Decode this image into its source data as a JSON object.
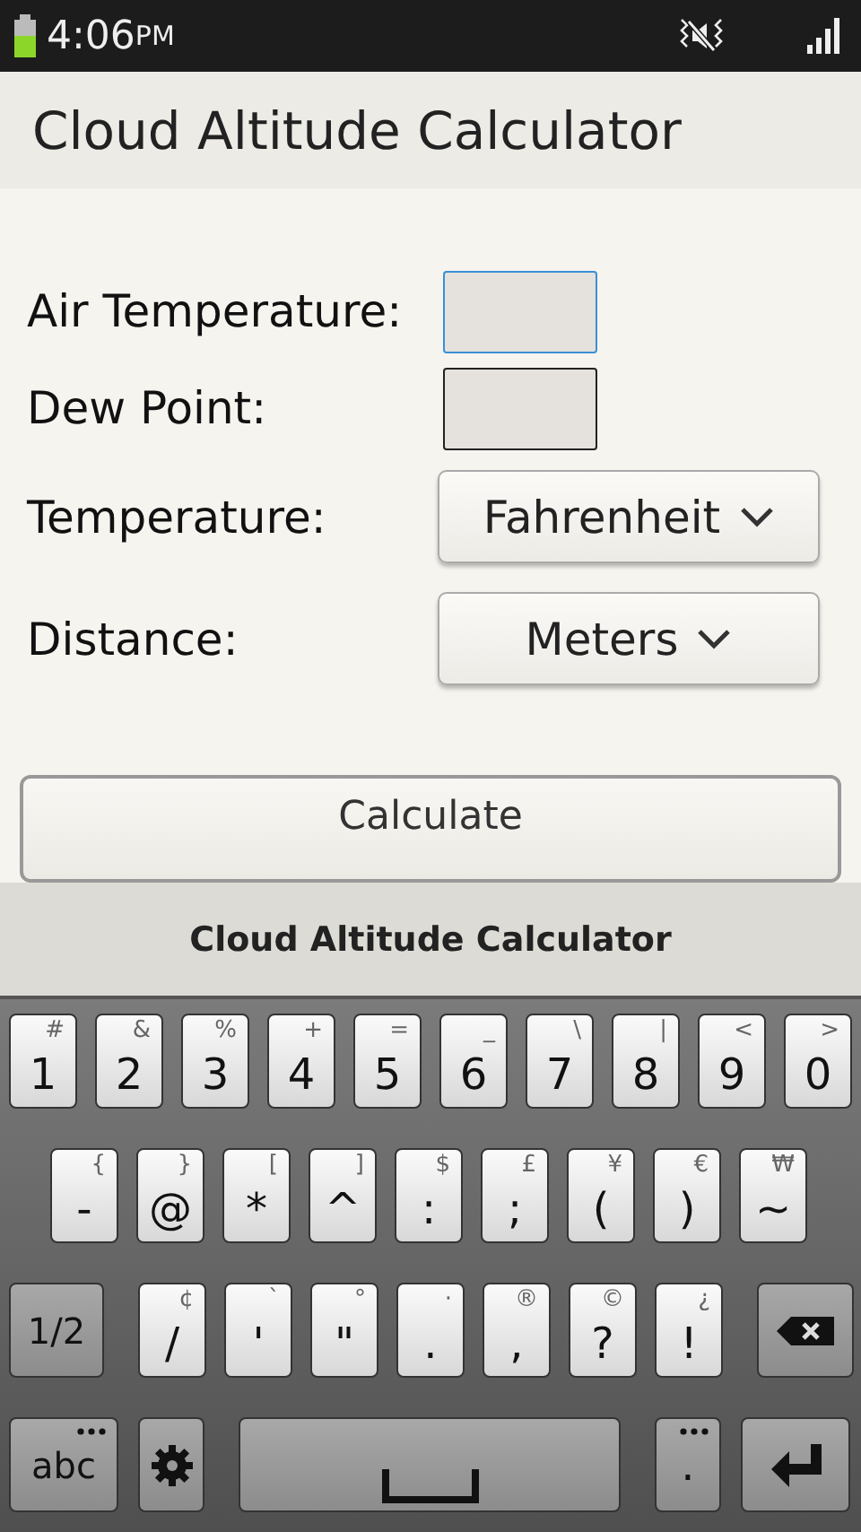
{
  "status_bar": {
    "time": "4:06",
    "ampm": "PM"
  },
  "app_bar": {
    "title": "Cloud Altitude Calculator"
  },
  "form": [
    {
      "kind": "input",
      "label": "Air Temperature:",
      "focused": true
    },
    {
      "kind": "input",
      "label": "Dew Point:",
      "focused": false
    },
    {
      "kind": "select",
      "label": "Temperature:",
      "value": "Fahrenheit"
    },
    {
      "kind": "select",
      "label": "Distance:",
      "value": "Meters"
    }
  ],
  "calculate_button": "Calculate",
  "ime_bar": {
    "title": "Cloud Altitude Calculator"
  },
  "keyboard": {
    "number_keys": [
      {
        "kind": "char",
        "main": "1",
        "alt": "#"
      },
      {
        "kind": "char",
        "main": "2",
        "alt": "&"
      },
      {
        "kind": "char",
        "main": "3",
        "alt": "%"
      },
      {
        "kind": "char",
        "main": "4",
        "alt": "+"
      },
      {
        "kind": "char",
        "main": "5",
        "alt": "="
      },
      {
        "kind": "char",
        "main": "6",
        "alt": "_"
      },
      {
        "kind": "char",
        "main": "7",
        "alt": "\\"
      },
      {
        "kind": "char",
        "main": "8",
        "alt": "|"
      },
      {
        "kind": "char",
        "main": "9",
        "alt": "<"
      },
      {
        "kind": "char",
        "main": "0",
        "alt": ">"
      }
    ],
    "symbol_keys": [
      {
        "kind": "char",
        "main": "-",
        "alt": "{"
      },
      {
        "kind": "char",
        "main": "@",
        "alt": "}"
      },
      {
        "kind": "char",
        "main": "*",
        "alt": "["
      },
      {
        "kind": "char",
        "main": "^",
        "alt": "]"
      },
      {
        "kind": "char",
        "main": ":",
        "alt": "$"
      },
      {
        "kind": "char",
        "main": ";",
        "alt": "£"
      },
      {
        "kind": "char",
        "main": "(",
        "alt": "¥"
      },
      {
        "kind": "char",
        "main": ")",
        "alt": "€"
      },
      {
        "kind": "char",
        "main": "~",
        "alt": "₩"
      }
    ],
    "punctuation_keys": [
      {
        "kind": "mode",
        "main": "1/2"
      },
      {
        "kind": "char",
        "main": "/",
        "alt": "¢"
      },
      {
        "kind": "char",
        "main": "'",
        "alt": "`"
      },
      {
        "kind": "char",
        "main": "\"",
        "alt": "°"
      },
      {
        "kind": "char",
        "main": ".",
        "alt": "·"
      },
      {
        "kind": "char",
        "main": ",",
        "alt": "®"
      },
      {
        "kind": "char",
        "main": "?",
        "alt": "©"
      },
      {
        "kind": "char",
        "main": "!",
        "alt": "¿"
      },
      {
        "kind": "backspace"
      }
    ],
    "bottom_keys": [
      {
        "kind": "abc",
        "main": "abc"
      },
      {
        "kind": "settings"
      },
      {
        "kind": "space"
      },
      {
        "kind": "period",
        "main": "."
      },
      {
        "kind": "enter"
      }
    ]
  }
}
